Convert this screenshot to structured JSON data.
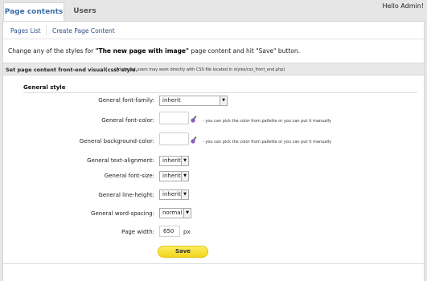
{
  "tabs": [
    {
      "label": "Page contents",
      "active": true
    },
    {
      "label": "Users",
      "active": false
    }
  ],
  "greeting": "Hello Admin!",
  "subnav": {
    "pages_list": "Pages List",
    "create_page": "Create Page Content"
  },
  "intro": {
    "prefix": "Change any of the styles for ",
    "page_name": "\"The new page with image\"",
    "suffix": " page content and hit \"Save\" button."
  },
  "section": {
    "title": "Set page content front-end visual(css) style.",
    "note": "(Advanced users may work directly with CSS file located in styles/css_front_end.php)"
  },
  "general_style": {
    "title": "General style",
    "font_family": {
      "label": "General font-family:",
      "value": "inherit"
    },
    "font_color": {
      "label": "General font-color:",
      "hint": "- you can pick the color from pallette or you can put it manually"
    },
    "background_color": {
      "label": "General background-color:",
      "hint": "- you can pick the color from pallette or you can put it manually"
    },
    "text_alignment": {
      "label": "General text-alignment:",
      "value": "inherit"
    },
    "font_size": {
      "label": "General font-size:",
      "value": "inherit"
    },
    "line_height": {
      "label": "General line-height:",
      "value": "inherit"
    },
    "word_spacing": {
      "label": "General word-spacing:",
      "value": "normal"
    },
    "page_width": {
      "label": "Page width:",
      "value": "650",
      "unit": "px"
    }
  },
  "save_label": "Save",
  "icons": {
    "dropdown": "chevron-down-icon",
    "picker": "color-picker-icon"
  },
  "colors": {
    "tab_text": "#3a6ea8",
    "link": "#2b4f8a",
    "save_button": "#f6e03a",
    "background": "#e6e6e6"
  }
}
